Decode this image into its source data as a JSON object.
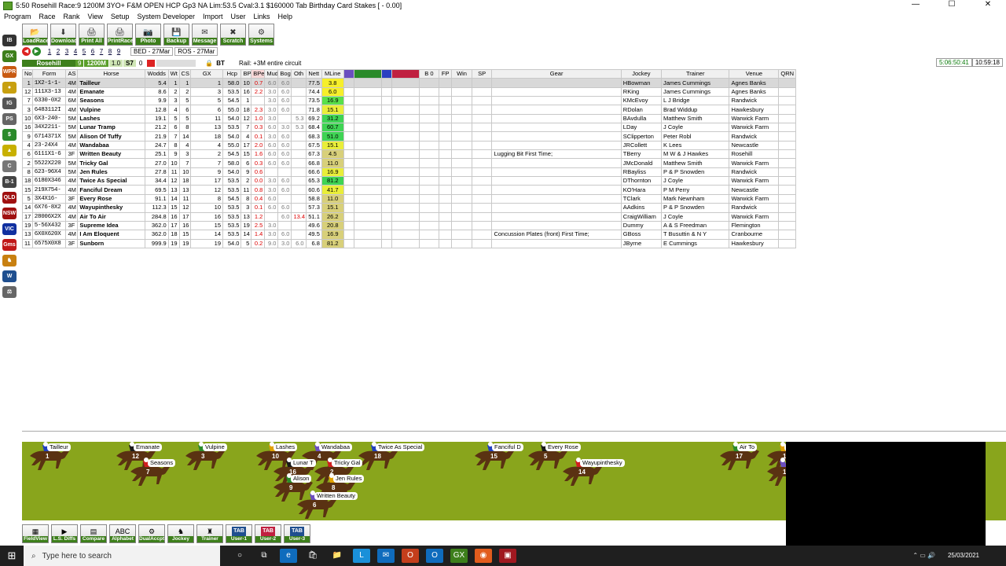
{
  "window": {
    "title": "5:50 Rosehill Race:9 1200M 3YO+ F&M OPEN HCP Gp3  NA Lim:53.5 Cval:3.1 $160000 Tab Birthday Card Stakes [ - 0.00]",
    "min": "—",
    "max": "☐",
    "close": "✕"
  },
  "menu": [
    "Program",
    "Race",
    "Rank",
    "View",
    "Setup",
    "System Developer",
    "Import",
    "User",
    "Links",
    "Help"
  ],
  "toolbar": [
    {
      "label": "LoadRace",
      "glyph": "📂",
      "icon": "folder-icon"
    },
    {
      "label": "Download",
      "glyph": "⬇",
      "icon": "download-icon"
    },
    {
      "label": "Print All",
      "glyph": "🖨",
      "icon": "printer-icon"
    },
    {
      "label": "PrintRace",
      "glyph": "🖨",
      "icon": "printer-icon"
    },
    {
      "label": "Photo",
      "glyph": "📷",
      "icon": "camera-icon"
    },
    {
      "label": "Backup",
      "glyph": "💾",
      "icon": "disk-icon"
    },
    {
      "label": "Message",
      "glyph": "✉",
      "icon": "envelope-icon"
    },
    {
      "label": "Scratch",
      "glyph": "✖",
      "icon": "scratch-icon"
    },
    {
      "label": "Systems",
      "glyph": "⚙",
      "icon": "gear-icon"
    }
  ],
  "sidebar": [
    {
      "text": "IB",
      "color": "#333"
    },
    {
      "text": "GX",
      "color": "#3d7f1b"
    },
    {
      "text": "WPR",
      "color": "#c85a12"
    },
    {
      "text": "●",
      "color": "#c8a010"
    },
    {
      "text": "IG",
      "color": "#555"
    },
    {
      "text": "PS",
      "color": "#666"
    },
    {
      "text": "$",
      "color": "#2a8a2a"
    },
    {
      "text": "▲",
      "color": "#c8b000"
    },
    {
      "text": "C",
      "color": "#777"
    },
    {
      "text": "B-1",
      "color": "#444"
    },
    {
      "text": "QLD",
      "color": "#a01010"
    },
    {
      "text": "NSW",
      "color": "#a01010"
    },
    {
      "text": "VIC",
      "color": "#1030a0"
    },
    {
      "text": "Gms",
      "color": "#c01818"
    },
    {
      "text": "♞",
      "color": "#c88010"
    },
    {
      "text": "W",
      "color": "#1f4f8f"
    },
    {
      "text": "⚖",
      "color": "#666"
    }
  ],
  "race_nav": {
    "numbers": [
      "1",
      "2",
      "3",
      "4",
      "5",
      "6",
      "7",
      "8",
      "9"
    ],
    "tabs": [
      "BED - 27Mar",
      "ROS - 27Mar"
    ]
  },
  "infobar": {
    "venue": "Rosehill",
    "race": "9",
    "distance": "1200M",
    "rating": "1.0",
    "track": "S7",
    "zero": "0",
    "code": "BT",
    "rail": "Rail: +3M entire circuit",
    "clock_green": "5:06:50:41",
    "time": "10:59:18"
  },
  "columns": [
    "No",
    "Form",
    "AS",
    "Horse",
    "Wodds",
    "Wt",
    "CS",
    "GX",
    "Hcp",
    "BP",
    "BPen",
    "Mud",
    "Bog",
    "Oth",
    "Nett",
    "MLine",
    "",
    "",
    "",
    "",
    "B 0",
    "FP",
    "Win",
    "SP",
    "Gear",
    "Jockey",
    "Trainer",
    "Venue",
    "QRN"
  ],
  "rows": [
    {
      "no": "1",
      "form": "1X2-1-1-",
      "as": "4M",
      "horse": "Tailleur",
      "wodds": "5.4",
      "wt": "1",
      "cs": "1",
      "gx": "1",
      "hcp": "58.0",
      "bp": "10",
      "bpen": "0.7",
      "mud": "6.0",
      "bog": "6.0",
      "oth": "",
      "nett": "77.5",
      "mline": "3.8",
      "mcol": "#f6ef2a",
      "gear": "",
      "jockey": "HBowman",
      "trainer": "James Cummings",
      "venue": "Agnes Banks"
    },
    {
      "no": "12",
      "form": "111X3-13",
      "as": "4M",
      "horse": "Emanate",
      "wodds": "8.6",
      "wt": "2",
      "cs": "2",
      "gx": "3",
      "hcp": "53.5",
      "bp": "16",
      "bpen": "2.2",
      "mud": "3.0",
      "bog": "6.0",
      "oth": "",
      "nett": "74.4",
      "mline": "6.0",
      "mcol": "#f6ef2a",
      "gear": "",
      "jockey": "RKing",
      "trainer": "James Cummings",
      "venue": "Agnes Banks"
    },
    {
      "no": "7",
      "form": "6330-0X2",
      "as": "6M",
      "horse": "Seasons",
      "wodds": "9.9",
      "wt": "3",
      "cs": "5",
      "gx": "5",
      "hcp": "54.5",
      "bp": "1",
      "bpen": "",
      "mud": "3.0",
      "bog": "6.0",
      "oth": "",
      "nett": "73.5",
      "mline": "16.9",
      "mcol": "#59e04a",
      "gear": "",
      "jockey": "KMcEvoy",
      "trainer": "L J Bridge",
      "venue": "Randwick"
    },
    {
      "no": "3",
      "form": "6483112I",
      "as": "4M",
      "horse": "Vulpine",
      "wodds": "12.8",
      "wt": "4",
      "cs": "6",
      "gx": "6",
      "hcp": "55.0",
      "bp": "18",
      "bpen": "2.3",
      "mud": "3.0",
      "bog": "6.0",
      "oth": "",
      "nett": "71.8",
      "mline": "15.1",
      "mcol": "#e9ee3a",
      "gear": "",
      "jockey": "RDolan",
      "trainer": "Brad Widdup",
      "venue": "Hawkesbury"
    },
    {
      "no": "10",
      "form": "6X3-240-",
      "as": "5M",
      "horse": "Lashes",
      "wodds": "19.1",
      "wt": "5",
      "cs": "5",
      "gx": "11",
      "hcp": "54.0",
      "bp": "12",
      "bpen": "1.0",
      "mud": "3.0",
      "bog": "",
      "oth": "5.3",
      "nett": "69.2",
      "mline": "31.2",
      "mcol": "#3fd454",
      "gear": "",
      "jockey": "BAvdulla",
      "trainer": "Matthew Smith",
      "venue": "Warwick Farm"
    },
    {
      "no": "16",
      "form": "34X2211-",
      "as": "5M",
      "horse": "Lunar Tramp",
      "wodds": "21.2",
      "wt": "6",
      "cs": "8",
      "gx": "13",
      "hcp": "53.5",
      "bp": "7",
      "bpen": "0.3",
      "mud": "6.0",
      "bog": "3.0",
      "oth": "5.3",
      "nett": "68.4",
      "mline": "60.7",
      "mcol": "#3fd454",
      "gear": "",
      "jockey": "LDay",
      "trainer": "J Coyle",
      "venue": "Warwick Farm"
    },
    {
      "no": "9",
      "form": "6714371X",
      "as": "5M",
      "horse": "Alison Of Tuffy",
      "wodds": "21.9",
      "wt": "7",
      "cs": "14",
      "gx": "18",
      "hcp": "54.0",
      "bp": "4",
      "bpen": "0.1",
      "mud": "3.0",
      "bog": "6.0",
      "oth": "",
      "nett": "68.3",
      "mline": "51.0",
      "mcol": "#3fd454",
      "gear": "",
      "jockey": "SClipperton",
      "trainer": "Peter Robl",
      "venue": "Randwick"
    },
    {
      "no": "4",
      "form": "23-24X4",
      "as": "4M",
      "horse": "Wandabaa",
      "wodds": "24.7",
      "wt": "8",
      "cs": "4",
      "gx": "4",
      "hcp": "55.0",
      "bp": "17",
      "bpen": "2.0",
      "mud": "6.0",
      "bog": "6.0",
      "oth": "",
      "nett": "67.5",
      "mline": "15.1",
      "mcol": "#e9ee3a",
      "gear": "",
      "jockey": "JRCollett",
      "trainer": "K Lees",
      "venue": "Newcastle"
    },
    {
      "no": "6",
      "form": "6111X1-6",
      "as": "3F",
      "horse": "Written Beauty",
      "wodds": "25.1",
      "wt": "9",
      "cs": "3",
      "gx": "2",
      "hcp": "54.5",
      "bp": "15",
      "bpen": "1.6",
      "mud": "6.0",
      "bog": "6.0",
      "oth": "",
      "nett": "67.3",
      "mline": "4.5",
      "mcol": "#d8d07a",
      "gear": "Lugging Bit First Time;",
      "jockey": "TBerry",
      "trainer": "M W & J Hawkes",
      "venue": "Rosehill"
    },
    {
      "no": "2",
      "form": "5522X220",
      "as": "5M",
      "horse": "Tricky Gal",
      "wodds": "27.0",
      "wt": "10",
      "cs": "7",
      "gx": "7",
      "hcp": "58.0",
      "bp": "6",
      "bpen": "0.3",
      "mud": "6.0",
      "bog": "6.0",
      "oth": "",
      "nett": "66.8",
      "mline": "11.0",
      "mcol": "#d8d07a",
      "gear": "",
      "jockey": "JMcDonald",
      "trainer": "Matthew Smith",
      "venue": "Warwick Farm"
    },
    {
      "no": "8",
      "form": "623-96X4",
      "as": "5M",
      "horse": "Jen Rules",
      "wodds": "27.8",
      "wt": "11",
      "cs": "10",
      "gx": "9",
      "hcp": "54.0",
      "bp": "9",
      "bpen": "0.6",
      "mud": "",
      "bog": "",
      "oth": "",
      "nett": "66.6",
      "mline": "16.9",
      "mcol": "#e9ee3a",
      "gear": "",
      "jockey": "RBayliss",
      "trainer": "P & P Snowden",
      "venue": "Randwick"
    },
    {
      "no": "18",
      "form": "6180X346",
      "as": "4M",
      "horse": "Twice As Special",
      "wodds": "34.4",
      "wt": "12",
      "cs": "18",
      "gx": "17",
      "hcp": "53.5",
      "bp": "2",
      "bpen": "0.0",
      "mud": "3.0",
      "bog": "6.0",
      "oth": "",
      "nett": "65.3",
      "mline": "81.2",
      "mcol": "#3fd454",
      "gear": "",
      "jockey": "DThornton",
      "trainer": "J Coyle",
      "venue": "Warwick Farm"
    },
    {
      "no": "15",
      "form": "219X754-",
      "as": "4M",
      "horse": "Fanciful Dream",
      "wodds": "69.5",
      "wt": "13",
      "cs": "13",
      "gx": "12",
      "hcp": "53.5",
      "bp": "11",
      "bpen": "0.8",
      "mud": "3.0",
      "bog": "6.0",
      "oth": "",
      "nett": "60.6",
      "mline": "41.7",
      "mcol": "#e9ee3a",
      "gear": "",
      "jockey": "KO'Hara",
      "trainer": "P M Perry",
      "venue": "Newcastle"
    },
    {
      "no": "5",
      "form": "3X4X16-",
      "as": "3F",
      "horse": "Every Rose",
      "wodds": "91.1",
      "wt": "14",
      "cs": "11",
      "gx": "8",
      "hcp": "54.5",
      "bp": "8",
      "bpen": "0.4",
      "mud": "6.0",
      "bog": "",
      "oth": "",
      "nett": "58.8",
      "mline": "11.0",
      "mcol": "#d8d07a",
      "gear": "",
      "jockey": "TClark",
      "trainer": "Mark Newnham",
      "venue": "Warwick Farm"
    },
    {
      "no": "14",
      "form": "6X76-8X2",
      "as": "4M",
      "horse": "Wayupinthesky",
      "wodds": "112.3",
      "wt": "15",
      "cs": "12",
      "gx": "10",
      "hcp": "53.5",
      "bp": "3",
      "bpen": "0.1",
      "mud": "6.0",
      "bog": "6.0",
      "oth": "",
      "nett": "57.3",
      "mline": "15.1",
      "mcol": "#d8d07a",
      "gear": "",
      "jockey": "AAdkins",
      "trainer": "P & P Snowden",
      "venue": "Randwick"
    },
    {
      "no": "17",
      "form": "28006X2X",
      "as": "4M",
      "horse": "Air To Air",
      "wodds": "284.8",
      "wt": "16",
      "cs": "17",
      "gx": "16",
      "hcp": "53.5",
      "bp": "13",
      "bpen": "1.2",
      "mud": "",
      "bog": "6.0",
      "oth": "13.4",
      "nett": "51.1",
      "mline": "26.2",
      "mcol": "#d8d07a",
      "gear": "",
      "jockey": "CraigWilliam",
      "trainer": "J Coyle",
      "venue": "Warwick Farm"
    },
    {
      "no": "19",
      "form": "5-56X432",
      "as": "3F",
      "horse": "Supreme Idea",
      "wodds": "362.0",
      "wt": "17",
      "cs": "16",
      "gx": "15",
      "hcp": "53.5",
      "bp": "19",
      "bpen": "2.5",
      "mud": "3.0",
      "bog": "",
      "oth": "",
      "nett": "49.6",
      "mline": "20.8",
      "mcol": "#d8d07a",
      "gear": "",
      "jockey": "Dummy",
      "trainer": "A & S Freedman",
      "venue": "Flemington"
    },
    {
      "no": "13",
      "form": "6X0X620X",
      "as": "4M",
      "horse": "I Am Eloquent",
      "wodds": "362.0",
      "wt": "18",
      "cs": "15",
      "gx": "14",
      "hcp": "53.5",
      "bp": "14",
      "bpen": "1.4",
      "mud": "3.0",
      "bog": "6.0",
      "oth": "",
      "nett": "49.5",
      "mline": "16.9",
      "mcol": "#d8d07a",
      "gear": "Concussion Plates (front) First Time;",
      "jockey": "GBoss",
      "trainer": "T Busuttin & N Y",
      "venue": "Cranbourne"
    },
    {
      "no": "11",
      "form": "6575X0X8",
      "as": "3F",
      "horse": "Sunborn",
      "wodds": "999.9",
      "wt": "19",
      "cs": "19",
      "gx": "19",
      "hcp": "54.0",
      "bp": "5",
      "bpen": "0.2",
      "mud": "9.0",
      "bog": "3.0",
      "oth": "6.0",
      "nett": "6.8",
      "mline": "81.2",
      "mcol": "#d8d07a",
      "gear": "",
      "jockey": "JByrne",
      "trainer": "E Cummings",
      "venue": "Hawkesbury"
    }
  ],
  "track": [
    {
      "name": "Tailleur",
      "num": "1"
    },
    {
      "name": "Emanate",
      "num": "12"
    },
    {
      "name": "Seasons",
      "num": "7"
    },
    {
      "name": "Vulpine",
      "num": "3"
    },
    {
      "name": "Lashes",
      "num": "10"
    },
    {
      "name": "Wandabaa",
      "num": "4"
    },
    {
      "name": "Twice As Special",
      "num": "18"
    },
    {
      "name": "Lunar T",
      "num": "16"
    },
    {
      "name": "Tricky Gal",
      "num": "2"
    },
    {
      "name": "Alison",
      "num": "9"
    },
    {
      "name": "Jen Rules",
      "num": "8"
    },
    {
      "name": "Written Beauty",
      "num": "6"
    },
    {
      "name": "Fanciful D",
      "num": "15"
    },
    {
      "name": "Every Rose",
      "num": "5"
    },
    {
      "name": "Wayupinthesky",
      "num": "14"
    },
    {
      "name": "Air To",
      "num": "17"
    },
    {
      "name": "Su",
      "num": "19"
    },
    {
      "name": "",
      "num": "13"
    }
  ],
  "bottom_buttons": [
    {
      "label": "FieldView",
      "glyph": "▦",
      "icon": "field-view-icon"
    },
    {
      "label": "L.S. Diffs",
      "glyph": "▶",
      "icon": "diffs-icon"
    },
    {
      "label": "Compare",
      "glyph": "▤",
      "icon": "compare-icon"
    },
    {
      "label": "Alphabet",
      "glyph": "ABC",
      "icon": "alphabet-icon"
    },
    {
      "label": "DualAccpt",
      "glyph": "⚙",
      "icon": "dual-accept-icon"
    },
    {
      "label": "Jockey",
      "glyph": "♞",
      "icon": "jockey-icon"
    },
    {
      "label": "Trainer",
      "glyph": "♜",
      "icon": "trainer-icon"
    },
    {
      "label": "User-1",
      "glyph": "TAB",
      "icon": "tab-icon"
    },
    {
      "label": "User-2",
      "glyph": "TAB",
      "icon": "tab-icon"
    },
    {
      "label": "User-3",
      "glyph": "TAB",
      "icon": "tab-icon"
    }
  ],
  "taskbar": {
    "search_placeholder": "Type here to search",
    "date": "25/03/2021",
    "apps": [
      {
        "glyph": "○",
        "color": "#1f1f1f",
        "icon": "task-view-icon"
      },
      {
        "glyph": "⧉",
        "color": "#1f1f1f",
        "icon": "multitask-icon"
      },
      {
        "glyph": "e",
        "color": "#0f6cbd",
        "icon": "edge-icon"
      },
      {
        "glyph": "🛍",
        "color": "#1f1f1f",
        "icon": "store-icon"
      },
      {
        "glyph": "📁",
        "color": "#1f1f1f",
        "icon": "explorer-icon"
      },
      {
        "glyph": "L",
        "color": "#1a90d9",
        "icon": "l-app-icon"
      },
      {
        "glyph": "✉",
        "color": "#0f6cbd",
        "icon": "mail-icon"
      },
      {
        "glyph": "O",
        "color": "#c43e1c",
        "icon": "office-icon"
      },
      {
        "glyph": "O",
        "color": "#0f6cbd",
        "icon": "outlook-icon"
      },
      {
        "glyph": "GX",
        "color": "#3d7f1b",
        "icon": "gx-app-icon"
      },
      {
        "glyph": "◉",
        "color": "#e25c1d",
        "icon": "firefox-icon"
      },
      {
        "glyph": "▣",
        "color": "#a01820",
        "icon": "app-icon"
      }
    ]
  }
}
